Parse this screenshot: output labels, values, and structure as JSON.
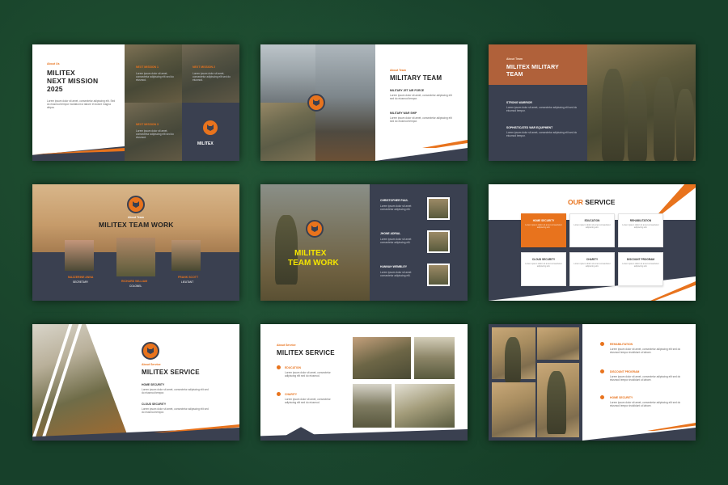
{
  "slide1": {
    "tag": "About Us",
    "title_line1": "MILITEX",
    "title_line2": "NEXT MISSION",
    "title_line3": "2025",
    "body": "Lorem ipsum dolor sit amet, consectetur adipiscing elit. Sed do eiusmod tempor incididunt ut labore et dolore magna aliqua.",
    "missions": [
      "NEXT MISSION 1",
      "NEXT MISSION 2",
      "NEXT MISSION 3"
    ],
    "mission_body": "Lorem ipsum dolor sit amet, consectetur adipiscing elit sed do eiusmod.",
    "brand": "MILITEX"
  },
  "slide2": {
    "tag": "About Team",
    "title": "MILITARY TEAM",
    "items": [
      {
        "title": "MILITARY JET AIR FORCE",
        "body": "Lorem ipsum dolor sit amet, consectetur adipiscing elit sed do eiusmod tempor."
      },
      {
        "title": "MILITARY WAR SHIP",
        "body": "Lorem ipsum dolor sit amet, consectetur adipiscing elit sed do eiusmod tempor."
      }
    ]
  },
  "slide3": {
    "tag": "About Team",
    "title_line1": "MILITEX MILITARY",
    "title_line2": "TEAM",
    "items": [
      {
        "title": "STRONG WARRIOR",
        "body": "Lorem ipsum dolor sit amet, consectetur adipiscing elit sed do eiusmod tempor."
      },
      {
        "title": "SOPHISTICATED WAR EQUIPMENT",
        "body": "Lorem ipsum dolor sit amet, consectetur adipiscing elit sed do eiusmod tempor."
      }
    ]
  },
  "slide4": {
    "tag": "About Team",
    "title": "MILITEX TEAM WORK",
    "members": [
      {
        "name": "MAZZERINE ANNA",
        "role": "SECRETARY"
      },
      {
        "name": "RICHARD WILLIAM",
        "role": "COLONEL"
      },
      {
        "name": "FRANK SCOTT",
        "role": "LIEUTANT"
      }
    ]
  },
  "slide5": {
    "title_line1": "MILITEX",
    "title_line2": "TEAM WORK",
    "members": [
      {
        "name": "CHRISTOPHER PAUL",
        "body": "Lorem ipsum dolor sit amet consectetur adipiscing elit."
      },
      {
        "name": "JHONE ADRIAL",
        "body": "Lorem ipsum dolor sit amet consectetur adipiscing elit."
      },
      {
        "name": "HANNAH WEMBLEY",
        "body": "Lorem ipsum dolor sit amet consectetur adipiscing elit."
      }
    ]
  },
  "slide6": {
    "title_prefix": "OUR",
    "title_suffix": "SERVICE",
    "cards": [
      {
        "title": "HOME SECURITY",
        "body": "Lorem ipsum dolor sit amet consectetur adipiscing elit."
      },
      {
        "title": "EDUCATION",
        "body": "Lorem ipsum dolor sit amet consectetur adipiscing elit."
      },
      {
        "title": "REHABILITATION",
        "body": "Lorem ipsum dolor sit amet consectetur adipiscing elit."
      },
      {
        "title": "CLOUD SECURITY",
        "body": "Lorem ipsum dolor sit amet consectetur adipiscing elit."
      },
      {
        "title": "CHARITY",
        "body": "Lorem ipsum dolor sit amet consectetur adipiscing elit."
      },
      {
        "title": "DISCOUNT PROGRAM",
        "body": "Lorem ipsum dolor sit amet consectetur adipiscing elit."
      }
    ]
  },
  "slide7": {
    "tag": "About Service",
    "title": "MILITEX SERVICE",
    "items": [
      {
        "title": "HOME SECURITY",
        "body": "Lorem ipsum dolor sit amet, consectetur adipiscing elit sed do eiusmod tempor."
      },
      {
        "title": "CLOUD SECURITY",
        "body": "Lorem ipsum dolor sit amet, consectetur adipiscing elit sed do eiusmod tempor."
      }
    ]
  },
  "slide8": {
    "tag": "About Service",
    "title": "MILITEX SERVICE",
    "items": [
      {
        "title": "EDUCATION",
        "body": "Lorem ipsum dolor sit amet, consectetur adipiscing elit sed do eiusmod."
      },
      {
        "title": "CHARITY",
        "body": "Lorem ipsum dolor sit amet, consectetur adipiscing elit sed do eiusmod."
      }
    ]
  },
  "slide9": {
    "items": [
      {
        "title": "REHABILITATION",
        "body": "Lorem ipsum dolor sit amet, consectetur adipiscing elit sed do eiusmod tempor incididunt ut labore."
      },
      {
        "title": "DISCOUNT PROGRAM",
        "body": "Lorem ipsum dolor sit amet, consectetur adipiscing elit sed do eiusmod tempor incididunt ut labore."
      },
      {
        "title": "HOME SECURITY",
        "body": "Lorem ipsum dolor sit amet, consectetur adipiscing elit sed do eiusmod tempor incididunt ut labore."
      }
    ]
  },
  "colors": {
    "accent": "#e8731d",
    "dark": "#3a4050",
    "background": "#1d4a2c"
  }
}
